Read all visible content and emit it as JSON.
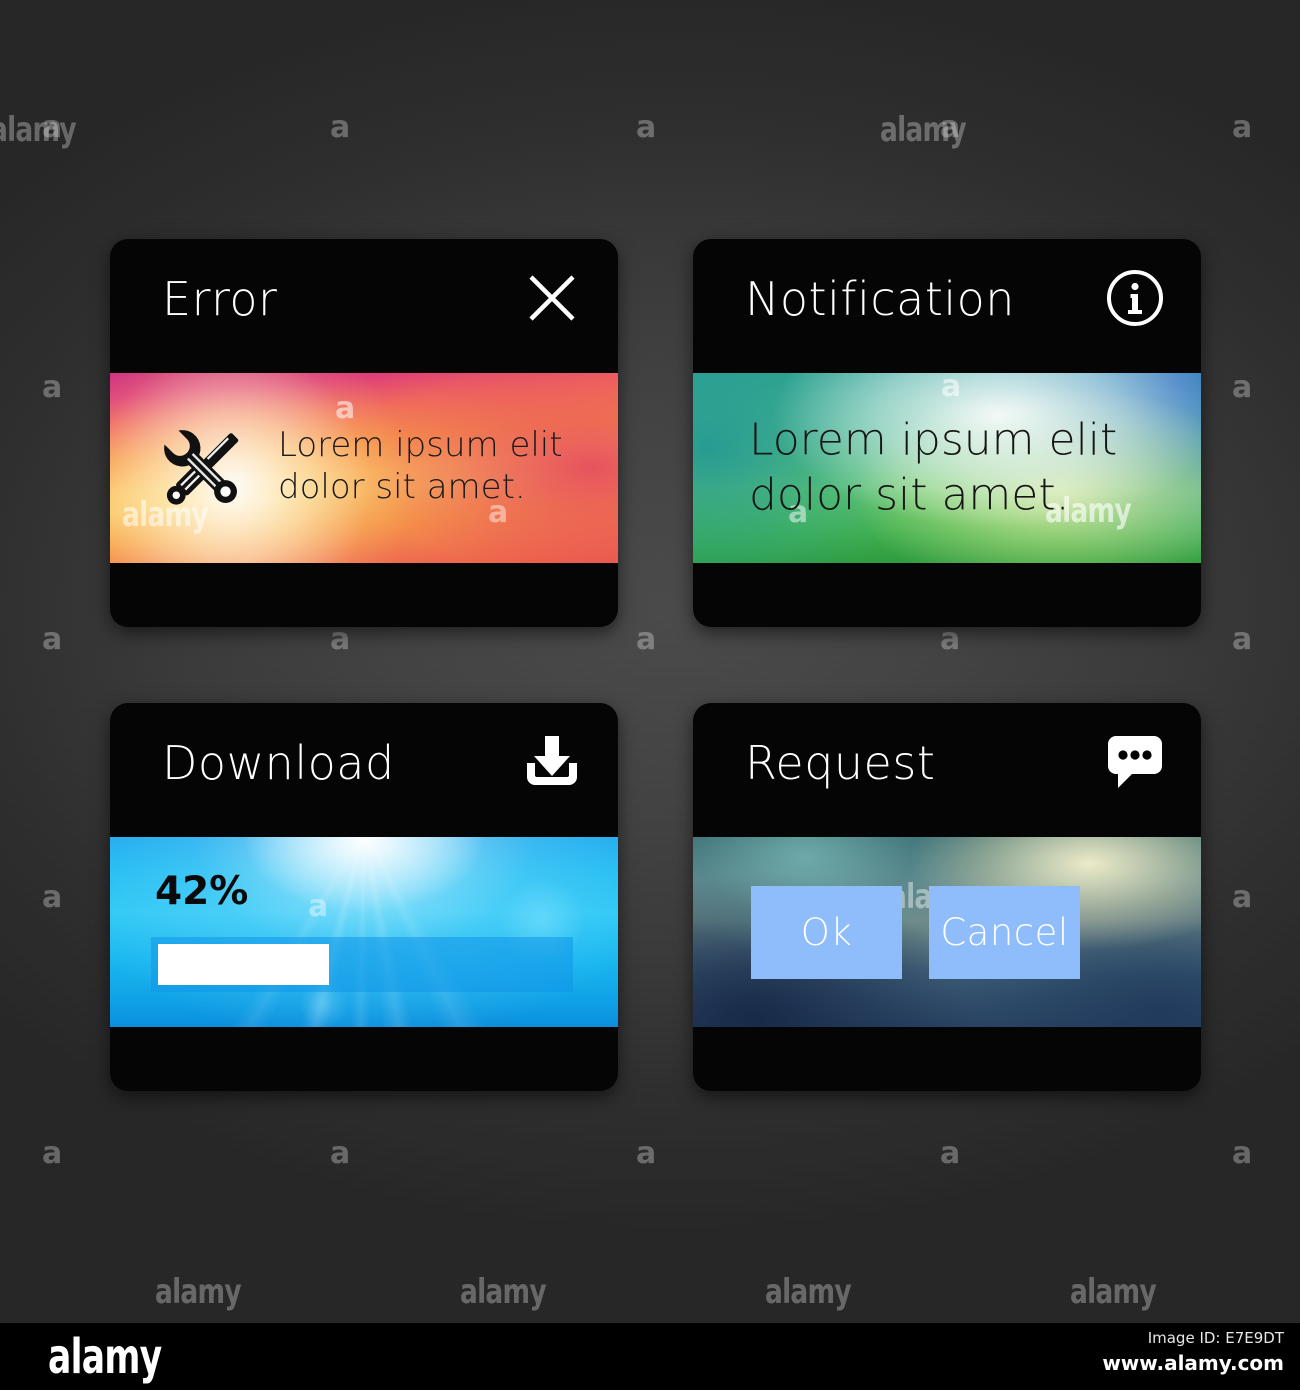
{
  "cards": [
    {
      "id": "error",
      "title": "Error",
      "icon": "close-icon",
      "body_icon": "wrench-screwdriver-icon",
      "message_line1": "Lorem ipsum elit",
      "message_line2": "dolor sit amet.",
      "accent": "#f8a84c"
    },
    {
      "id": "notification",
      "title": "Notification",
      "icon": "info-circle-icon",
      "message_line1": "Lorem ipsum elit",
      "message_line2": "dolor sit amet.",
      "accent": "#4fb96a"
    },
    {
      "id": "download",
      "title": "Download",
      "icon": "download-icon",
      "progress_label": "42%",
      "progress_value": 42,
      "accent": "#1fbcf2"
    },
    {
      "id": "request",
      "title": "Request",
      "icon": "chat-bubble-dots-icon",
      "buttons": [
        {
          "label": "Ok",
          "name": "ok-button"
        },
        {
          "label": "Cancel",
          "name": "cancel-button"
        }
      ],
      "accent": "#8fbdfb"
    }
  ],
  "watermarks": {
    "letter": "a",
    "word": "alamy"
  },
  "footer": {
    "logo": "alamy",
    "image_id": "Image ID: E7E9DT",
    "url": "www.alamy.com"
  }
}
